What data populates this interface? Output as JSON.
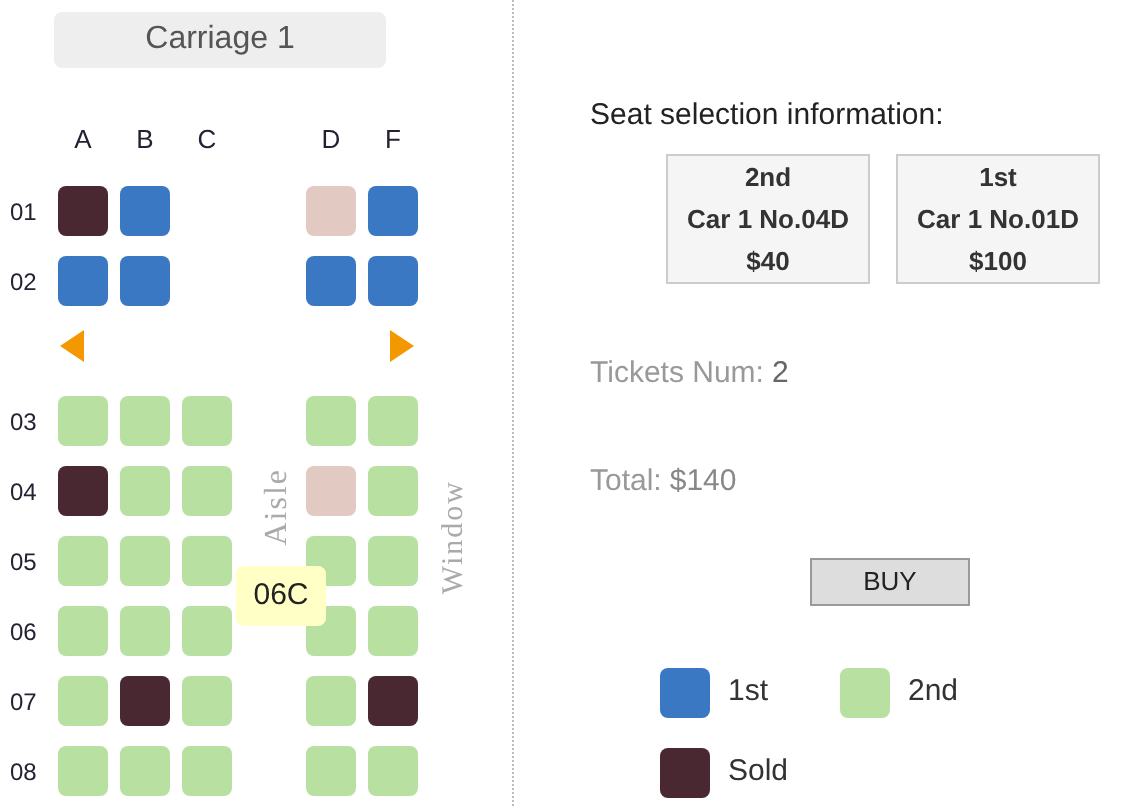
{
  "carriage": {
    "title": "Carriage 1"
  },
  "columns": [
    "A",
    "B",
    "C",
    "D",
    "F"
  ],
  "rows": [
    {
      "label": "01",
      "seats": [
        {
          "kind": "first",
          "sold": true,
          "selected": false
        },
        {
          "kind": "first",
          "sold": false,
          "selected": false
        },
        {
          "kind": "gap"
        },
        {
          "kind": "first",
          "sold": false,
          "selected": true
        },
        {
          "kind": "first",
          "sold": false,
          "selected": false
        }
      ]
    },
    {
      "label": "02",
      "seats": [
        {
          "kind": "first",
          "sold": false,
          "selected": false
        },
        {
          "kind": "first",
          "sold": false,
          "selected": false
        },
        {
          "kind": "gap"
        },
        {
          "kind": "first",
          "sold": false,
          "selected": false
        },
        {
          "kind": "first",
          "sold": false,
          "selected": false
        }
      ]
    },
    {
      "kind": "arrows"
    },
    {
      "label": "03",
      "seats": [
        {
          "kind": "second",
          "sold": false,
          "selected": false
        },
        {
          "kind": "second",
          "sold": false,
          "selected": false
        },
        {
          "kind": "second",
          "sold": false,
          "selected": false
        },
        {
          "kind": "second",
          "sold": false,
          "selected": false
        },
        {
          "kind": "second",
          "sold": false,
          "selected": false
        }
      ]
    },
    {
      "label": "04",
      "seats": [
        {
          "kind": "second",
          "sold": true,
          "selected": false
        },
        {
          "kind": "second",
          "sold": false,
          "selected": false
        },
        {
          "kind": "second",
          "sold": false,
          "selected": false
        },
        {
          "kind": "second",
          "sold": false,
          "selected": true
        },
        {
          "kind": "second",
          "sold": false,
          "selected": false
        }
      ]
    },
    {
      "label": "05",
      "seats": [
        {
          "kind": "second",
          "sold": false,
          "selected": false
        },
        {
          "kind": "second",
          "sold": false,
          "selected": false
        },
        {
          "kind": "second",
          "sold": false,
          "selected": false
        },
        {
          "kind": "second",
          "sold": false,
          "selected": false
        },
        {
          "kind": "second",
          "sold": false,
          "selected": false
        }
      ]
    },
    {
      "label": "06",
      "seats": [
        {
          "kind": "second",
          "sold": false,
          "selected": false
        },
        {
          "kind": "second",
          "sold": false,
          "selected": false
        },
        {
          "kind": "second",
          "sold": false,
          "selected": false
        },
        {
          "kind": "second",
          "sold": false,
          "selected": false
        },
        {
          "kind": "second",
          "sold": false,
          "selected": false
        }
      ]
    },
    {
      "label": "07",
      "seats": [
        {
          "kind": "second",
          "sold": false,
          "selected": false
        },
        {
          "kind": "second",
          "sold": true,
          "selected": false
        },
        {
          "kind": "second",
          "sold": false,
          "selected": false
        },
        {
          "kind": "second",
          "sold": false,
          "selected": false
        },
        {
          "kind": "second",
          "sold": true,
          "selected": false
        }
      ]
    },
    {
      "label": "08",
      "seats": [
        {
          "kind": "second",
          "sold": false,
          "selected": false
        },
        {
          "kind": "second",
          "sold": false,
          "selected": false
        },
        {
          "kind": "second",
          "sold": false,
          "selected": false
        },
        {
          "kind": "second",
          "sold": false,
          "selected": false
        },
        {
          "kind": "second",
          "sold": false,
          "selected": false
        }
      ]
    }
  ],
  "aisle_label": "Aisle",
  "window_label": "Window",
  "tooltip": "06C",
  "selection": {
    "title": "Seat selection information:",
    "tickets": [
      {
        "class": "2nd",
        "seat": "Car 1 No.04D",
        "price": "$40"
      },
      {
        "class": "1st",
        "seat": "Car 1 No.01D",
        "price": "$100"
      }
    ]
  },
  "tickets_num": {
    "label": "Tickets Num:",
    "value": "2"
  },
  "total": {
    "label": "Total:",
    "value": "$140"
  },
  "buy_button": "BUY",
  "legend": [
    {
      "label": "1st",
      "color": "#3a78c4"
    },
    {
      "label": "2nd",
      "color": "#b8e0a0"
    },
    {
      "label": "Sold",
      "color": "#4a2832"
    }
  ]
}
